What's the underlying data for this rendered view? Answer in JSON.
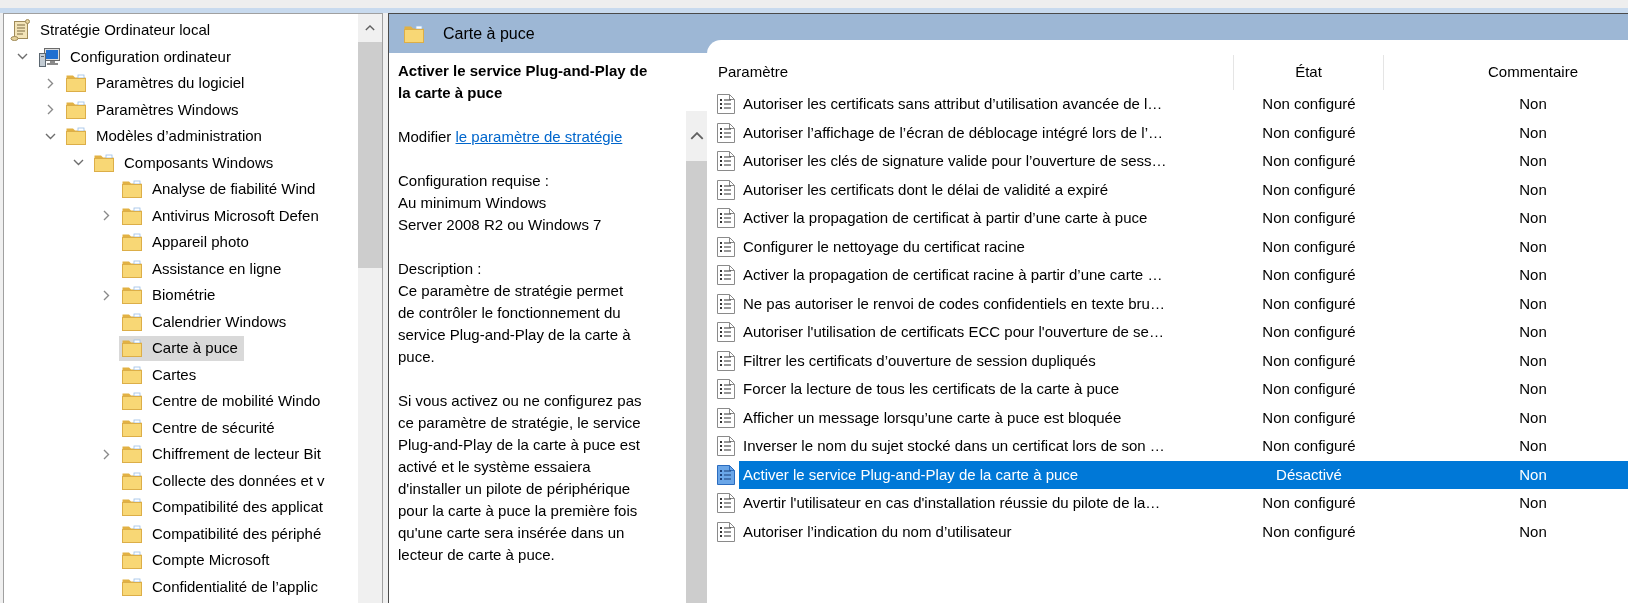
{
  "tree": {
    "items": [
      {
        "kind": "root",
        "label": "Stratégie Ordinateur local",
        "selected": false,
        "children": [
          {
            "kind": "computer",
            "label": "Configuration ordinateur",
            "expanded": true,
            "selected": false,
            "children": [
              {
                "kind": "folder",
                "label": "Paramètres du logiciel",
                "expanded": false,
                "selected": false
              },
              {
                "kind": "folder",
                "label": "Paramètres Windows",
                "expanded": false,
                "selected": false
              },
              {
                "kind": "folder",
                "label": "Modèles d’administration",
                "expanded": true,
                "selected": false,
                "children": [
                  {
                    "kind": "folder",
                    "label": "Composants Windows",
                    "expanded": true,
                    "selected": false,
                    "children": [
                      {
                        "kind": "folder",
                        "label": "Analyse de fiabilité Wind",
                        "selected": false
                      },
                      {
                        "kind": "folder",
                        "label": "Antivirus Microsoft Defen",
                        "expanded": false,
                        "selected": false
                      },
                      {
                        "kind": "folder",
                        "label": "Appareil photo",
                        "selected": false
                      },
                      {
                        "kind": "folder",
                        "label": "Assistance en ligne",
                        "selected": false
                      },
                      {
                        "kind": "folder",
                        "label": "Biométrie",
                        "expanded": false,
                        "selected": false
                      },
                      {
                        "kind": "folder",
                        "label": "Calendrier Windows",
                        "selected": false
                      },
                      {
                        "kind": "folder",
                        "label": "Carte à puce",
                        "selected": true
                      },
                      {
                        "kind": "folder",
                        "label": "Cartes",
                        "selected": false
                      },
                      {
                        "kind": "folder",
                        "label": "Centre de mobilité Windo",
                        "selected": false
                      },
                      {
                        "kind": "folder",
                        "label": "Centre de sécurité",
                        "selected": false
                      },
                      {
                        "kind": "folder",
                        "label": "Chiffrement de lecteur Bit",
                        "expanded": false,
                        "selected": false
                      },
                      {
                        "kind": "folder",
                        "label": "Collecte des données et v",
                        "selected": false
                      },
                      {
                        "kind": "folder",
                        "label": "Compatibilité des applicat",
                        "selected": false
                      },
                      {
                        "kind": "folder",
                        "label": "Compatibilité des périphé",
                        "selected": false
                      },
                      {
                        "kind": "folder",
                        "label": "Compte Microsoft",
                        "selected": false
                      },
                      {
                        "kind": "folder",
                        "label": "Confidentialité de l’applic",
                        "selected": false
                      }
                    ]
                  }
                ]
              }
            ]
          }
        ]
      }
    ]
  },
  "header": {
    "title": "Carte à puce"
  },
  "details": {
    "title": "Activer le service Plug-and-Play de la carte à puce",
    "edit": {
      "text": "Modifier",
      "link": "le paramètre de stratégie"
    },
    "requirements": {
      "label": "Configuration requise :",
      "lines": [
        "Au minimum Windows",
        "Server 2008 R2 ou Windows 7"
      ]
    },
    "description": {
      "label": "Description :",
      "paragraphs": [
        "Ce paramètre de stratégie permet de contrôler le fonctionnement du service Plug-and-Play de la carte à puce.",
        "Si vous activez ou ne configurez pas ce paramètre de stratégie, le service Plug-and-Play de la carte à puce est activé et le système essaiera d'installer un pilote de périphérique pour la carte à puce la première fois qu'une carte sera insérée dans un lecteur de carte à puce."
      ]
    }
  },
  "table": {
    "columns": [
      "Paramètre",
      "État",
      "Commentaire"
    ],
    "rows": [
      {
        "parameter": "Autoriser les certificats sans attribut d’utilisation avancée de l…",
        "state": "Non configuré",
        "comment": "Non",
        "selected": false
      },
      {
        "parameter": "Autoriser l’affichage de l’écran de déblocage intégré lors de l’…",
        "state": "Non configuré",
        "comment": "Non",
        "selected": false
      },
      {
        "parameter": "Autoriser les clés de signature valide pour l’ouverture de sess…",
        "state": "Non configuré",
        "comment": "Non",
        "selected": false
      },
      {
        "parameter": "Autoriser les certificats dont le délai de validité a expiré",
        "state": "Non configuré",
        "comment": "Non",
        "selected": false
      },
      {
        "parameter": "Activer la propagation de certificat à partir d’une carte à puce",
        "state": "Non configuré",
        "comment": "Non",
        "selected": false
      },
      {
        "parameter": "Configurer le nettoyage du certificat racine",
        "state": "Non configuré",
        "comment": "Non",
        "selected": false
      },
      {
        "parameter": "Activer la propagation de certificat racine à partir d’une carte …",
        "state": "Non configuré",
        "comment": "Non",
        "selected": false
      },
      {
        "parameter": "Ne pas autoriser le renvoi de codes confidentiels en texte bru…",
        "state": "Non configuré",
        "comment": "Non",
        "selected": false
      },
      {
        "parameter": "Autoriser l'utilisation de certificats ECC pour l'ouverture de se…",
        "state": "Non configuré",
        "comment": "Non",
        "selected": false
      },
      {
        "parameter": "Filtrer les certificats d’ouverture de session dupliqués",
        "state": "Non configuré",
        "comment": "Non",
        "selected": false
      },
      {
        "parameter": "Forcer la lecture de tous les certificats de la carte à puce",
        "state": "Non configuré",
        "comment": "Non",
        "selected": false
      },
      {
        "parameter": "Afficher un message lorsqu’une carte à puce est bloquée",
        "state": "Non configuré",
        "comment": "Non",
        "selected": false
      },
      {
        "parameter": "Inverser le nom du sujet stocké dans un certificat lors de son …",
        "state": "Non configuré",
        "comment": "Non",
        "selected": false
      },
      {
        "parameter": "Activer le service Plug-and-Play de la carte à puce",
        "state": "Désactivé",
        "comment": "Non",
        "selected": true
      },
      {
        "parameter": "Avertir l'utilisateur en cas d'installation réussie du pilote de la…",
        "state": "Non configuré",
        "comment": "Non",
        "selected": false
      },
      {
        "parameter": "Autoriser l’indication du nom d’utilisateur",
        "state": "Non configuré",
        "comment": "Non",
        "selected": false
      }
    ]
  }
}
